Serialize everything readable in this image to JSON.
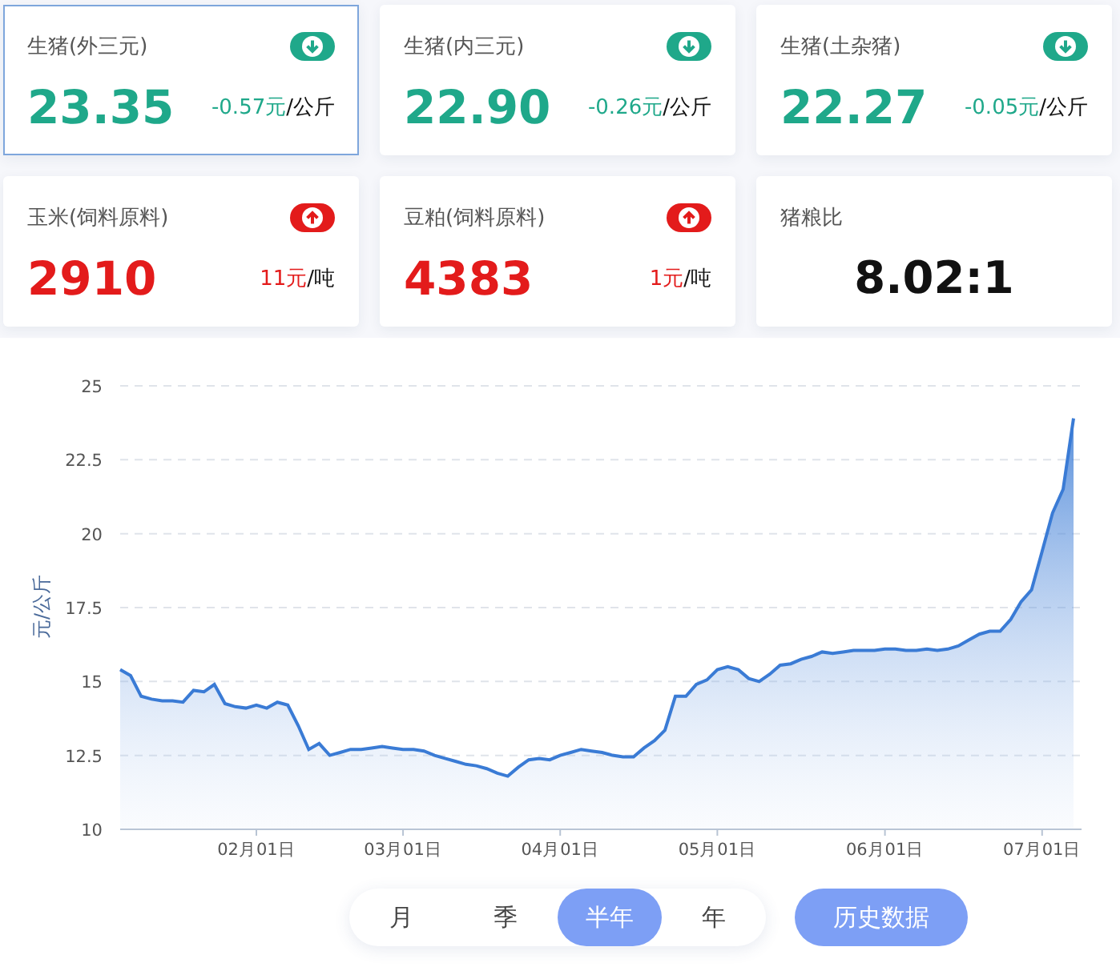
{
  "cards": [
    {
      "kind": "down",
      "name": "生猪(外三元)",
      "value": "23.35",
      "change": "-0.57元",
      "unit": "/公斤",
      "selected": true
    },
    {
      "kind": "down",
      "name": "生猪(内三元)",
      "value": "22.90",
      "change": "-0.26元",
      "unit": "/公斤",
      "selected": false
    },
    {
      "kind": "down",
      "name": "生猪(土杂猪)",
      "value": "22.27",
      "change": "-0.05元",
      "unit": "/公斤",
      "selected": false
    },
    {
      "kind": "up",
      "name": "玉米(饲料原料)",
      "value": "2910",
      "change": "11元",
      "unit": "/吨",
      "selected": false
    },
    {
      "kind": "up",
      "name": "豆粕(饲料原料)",
      "value": "4383",
      "change": "1元",
      "unit": "/吨",
      "selected": false
    },
    {
      "kind": "ratio",
      "name": "猪粮比",
      "value": "8.02:1",
      "selected": false
    }
  ],
  "chart": {
    "chart_data": {
      "type": "area",
      "grid": true,
      "ylabel": "元/公斤",
      "ylim": [
        10,
        25
      ],
      "yticks": [
        10,
        12.5,
        15,
        17.5,
        20,
        22.5,
        25
      ],
      "categories": [
        null,
        null,
        null,
        null,
        null,
        null,
        null,
        null,
        null,
        null,
        null,
        null,
        null,
        "02月01日",
        null,
        null,
        null,
        null,
        null,
        null,
        null,
        null,
        null,
        null,
        null,
        null,
        null,
        "03月01日",
        null,
        null,
        null,
        null,
        null,
        null,
        null,
        null,
        null,
        null,
        null,
        null,
        null,
        null,
        "04月01日",
        null,
        null,
        null,
        null,
        null,
        null,
        null,
        null,
        null,
        null,
        null,
        null,
        null,
        null,
        "05月01日",
        null,
        null,
        null,
        null,
        null,
        null,
        null,
        null,
        null,
        null,
        null,
        null,
        null,
        null,
        null,
        "06月01日",
        null,
        null,
        null,
        null,
        null,
        null,
        null,
        null,
        null,
        null,
        null,
        null,
        null,
        null,
        "07月01日",
        null,
        null,
        null
      ],
      "series": [
        {
          "color": "#3a7bd5",
          "values": [
            15.4,
            15.2,
            14.5,
            14.4,
            14.35,
            14.35,
            14.3,
            14.7,
            14.65,
            14.9,
            14.25,
            14.15,
            14.1,
            14.2,
            14.1,
            14.3,
            14.2,
            13.5,
            12.7,
            12.9,
            12.5,
            12.6,
            12.7,
            12.7,
            12.75,
            12.8,
            12.75,
            12.7,
            12.7,
            12.65,
            12.5,
            12.4,
            12.3,
            12.2,
            12.15,
            12.05,
            11.9,
            11.8,
            12.1,
            12.35,
            12.4,
            12.35,
            12.5,
            12.6,
            12.7,
            12.65,
            12.6,
            12.5,
            12.45,
            12.45,
            12.75,
            13.0,
            13.35,
            14.5,
            14.5,
            14.9,
            15.05,
            15.4,
            15.5,
            15.4,
            15.1,
            15.0,
            15.25,
            15.55,
            15.6,
            15.75,
            15.85,
            16.0,
            15.95,
            16.0,
            16.05,
            16.05,
            16.05,
            16.1,
            16.1,
            16.05,
            16.05,
            16.1,
            16.05,
            16.1,
            16.2,
            16.4,
            16.6,
            16.7,
            16.7,
            17.1,
            17.7,
            18.1,
            19.4,
            20.7,
            21.5,
            23.9
          ]
        }
      ]
    }
  },
  "periods": [
    {
      "label": "月",
      "selected": false
    },
    {
      "label": "季",
      "selected": false
    },
    {
      "label": "半年",
      "selected": true
    },
    {
      "label": "年",
      "selected": false
    }
  ],
  "history_button": "历史数据"
}
